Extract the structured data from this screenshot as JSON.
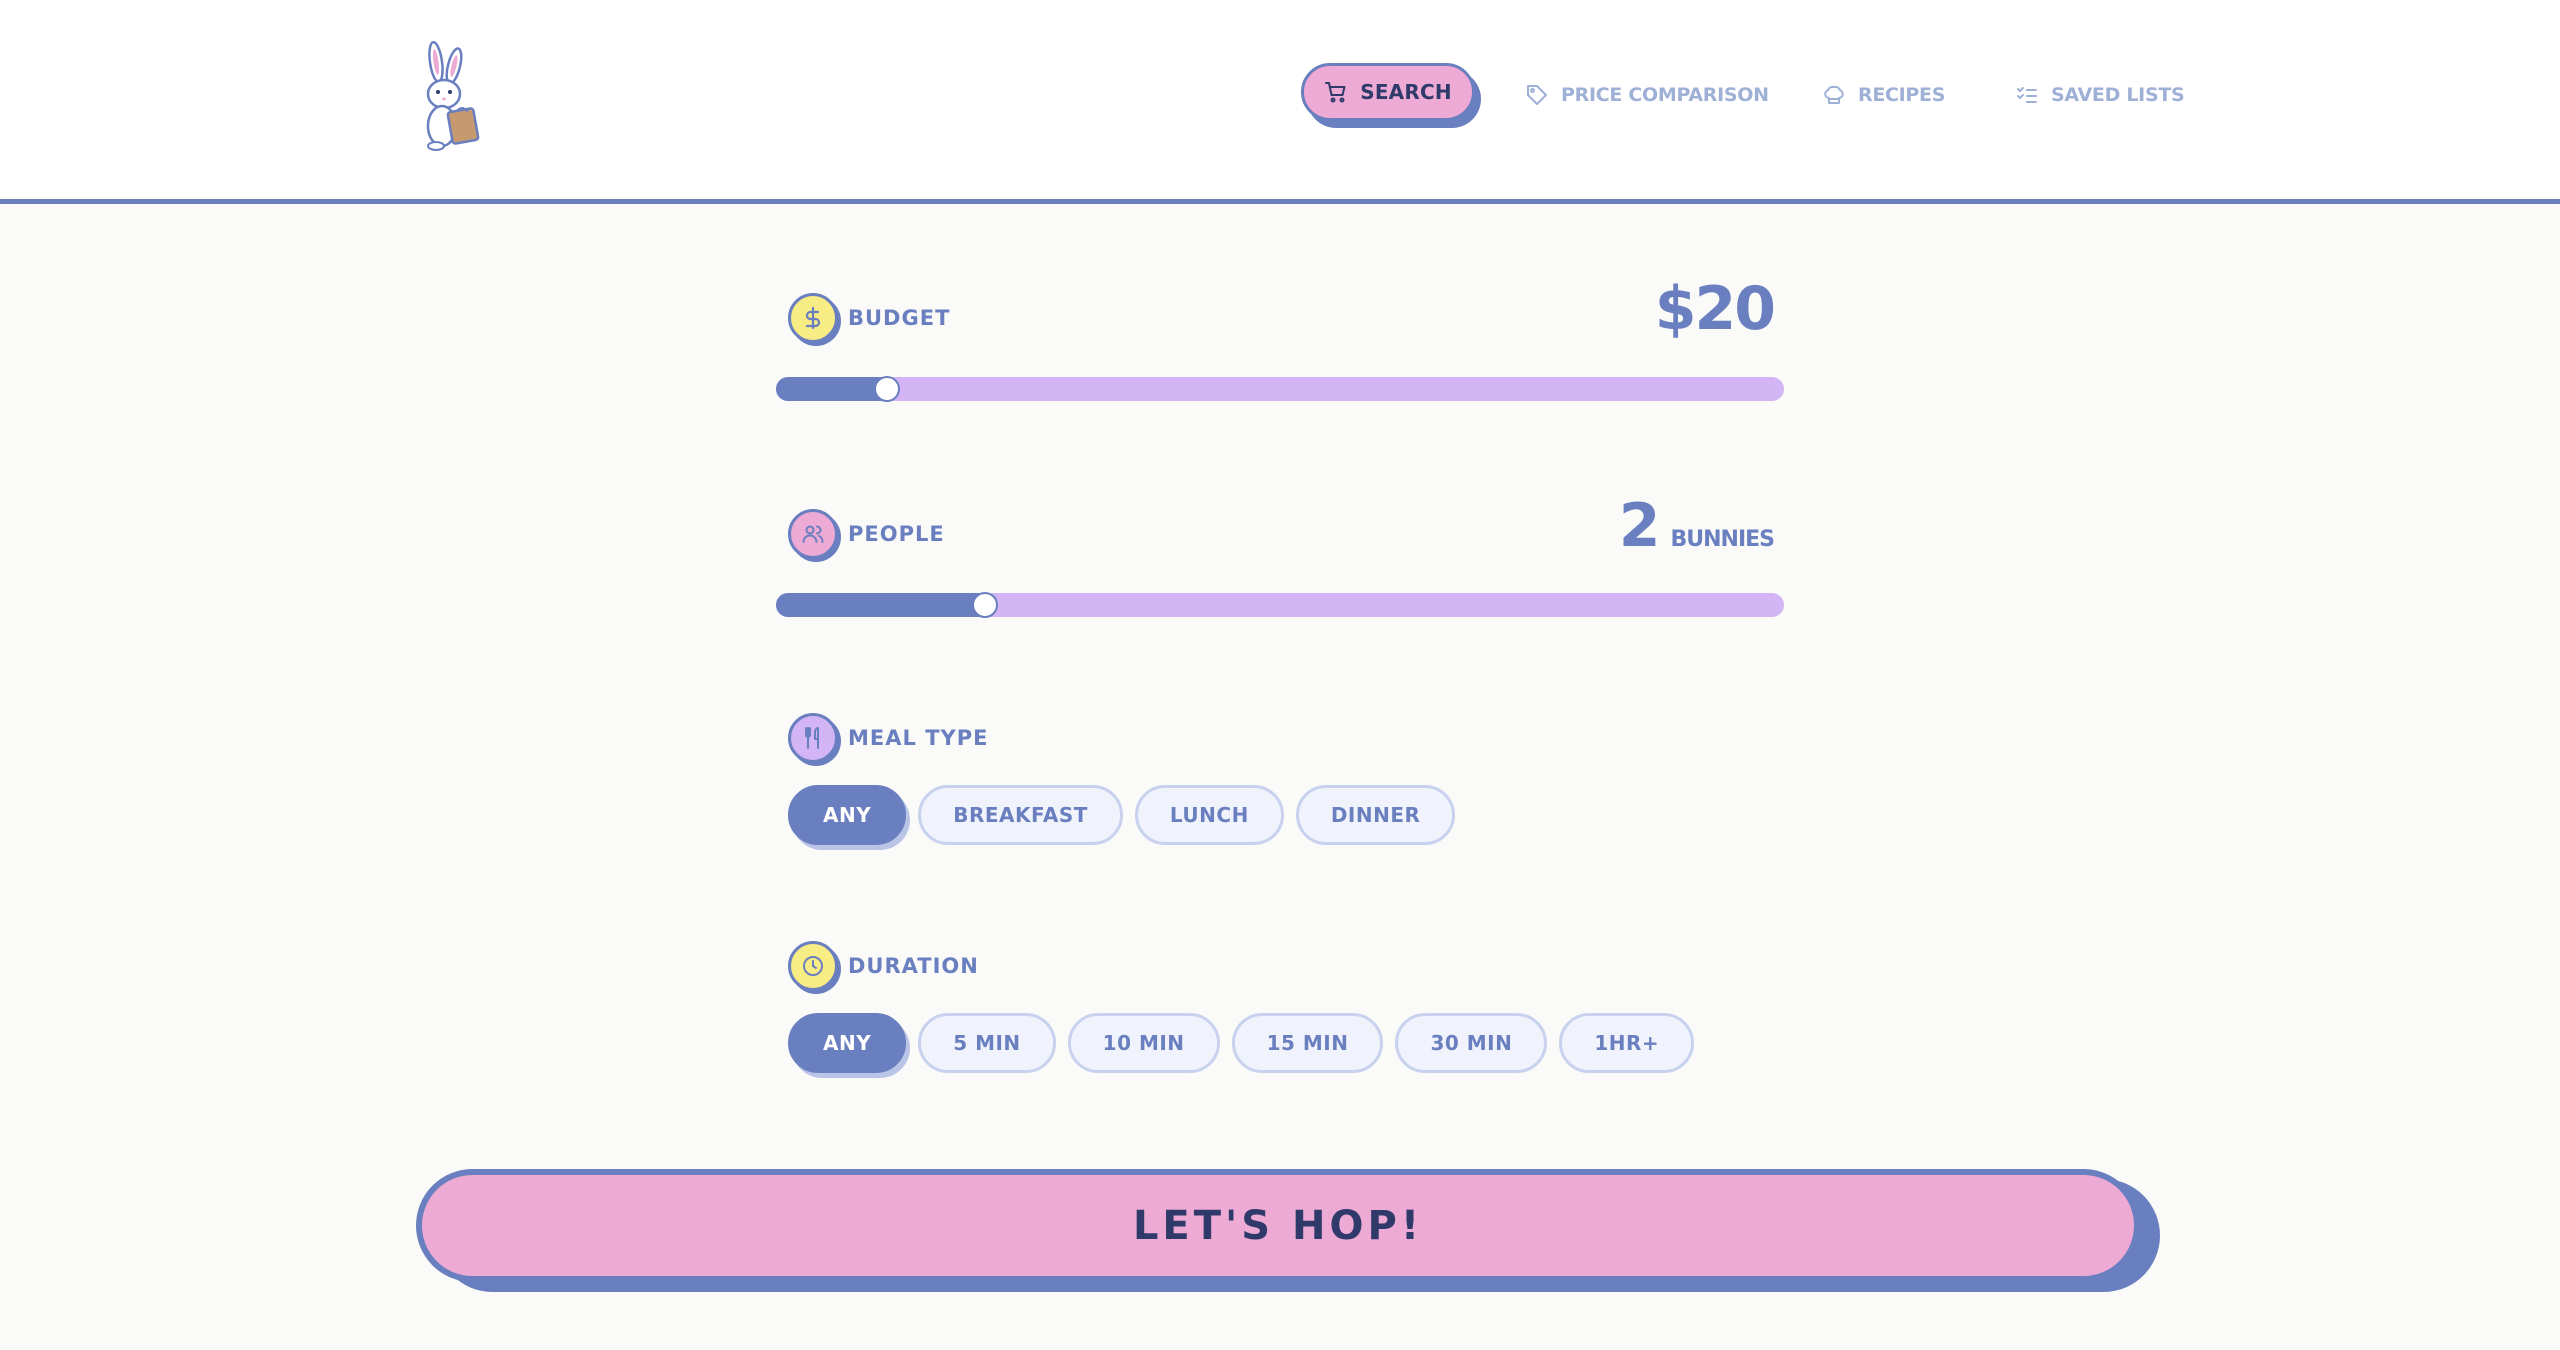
{
  "nav": {
    "search": "SEARCH",
    "price_comparison": "PRICE COMPARISON",
    "recipes": "RECIPES",
    "saved_lists": "SAVED LISTS"
  },
  "budget": {
    "label": "BUDGET",
    "value": "$20",
    "slider_fraction": 0.11
  },
  "people": {
    "label": "PEOPLE",
    "value": "2",
    "unit": "BUNNIES",
    "slider_fraction": 0.207
  },
  "meal_type": {
    "label": "MEAL TYPE",
    "options": [
      "ANY",
      "BREAKFAST",
      "LUNCH",
      "DINNER"
    ],
    "selected": "ANY"
  },
  "duration": {
    "label": "DURATION",
    "options": [
      "ANY",
      "5 MIN",
      "10 MIN",
      "15 MIN",
      "30 MIN",
      "1HR+"
    ],
    "selected": "ANY"
  },
  "cta": "LET'S HOP!",
  "colors": {
    "primary": "#6a7fbf",
    "pink": "#ecaad4",
    "lavender": "#d3b5f5",
    "yellow": "#f8ec84",
    "navy": "#2f3a6a",
    "muted": "#9fb0d6"
  },
  "icons": {
    "logo": "bunny-with-grocery-bag",
    "search": "cart-icon",
    "price_comparison": "tag-icon",
    "recipes": "chef-hat-icon",
    "saved_lists": "checklist-icon",
    "budget": "dollar-icon",
    "people": "users-icon",
    "meal_type": "utensils-icon",
    "duration": "clock-icon"
  }
}
